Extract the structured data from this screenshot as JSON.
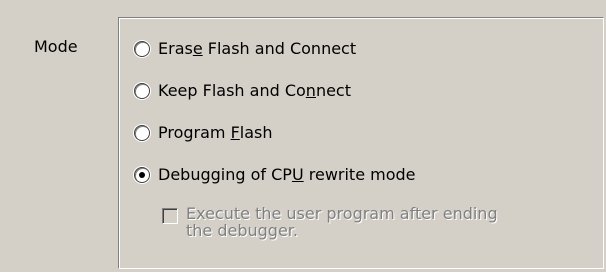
{
  "mode_label": "Mode",
  "options": [
    {
      "pre": "Eras",
      "key": "e",
      "post": " Flash and Connect",
      "selected": false
    },
    {
      "pre": "Keep Flash and Co",
      "key": "n",
      "post": "nect",
      "selected": false
    },
    {
      "pre": "Program ",
      "key": "F",
      "post": "lash",
      "selected": false
    },
    {
      "pre": "Debugging of CP",
      "key": "U",
      "post": " rewrite mode",
      "selected": true
    }
  ],
  "checkbox": {
    "line1": "Execute the user program after ending",
    "line2": "the debugger.",
    "checked": false,
    "enabled": false
  },
  "colors": {
    "face": "#d4d0c8",
    "disabled_text": "#808080"
  }
}
